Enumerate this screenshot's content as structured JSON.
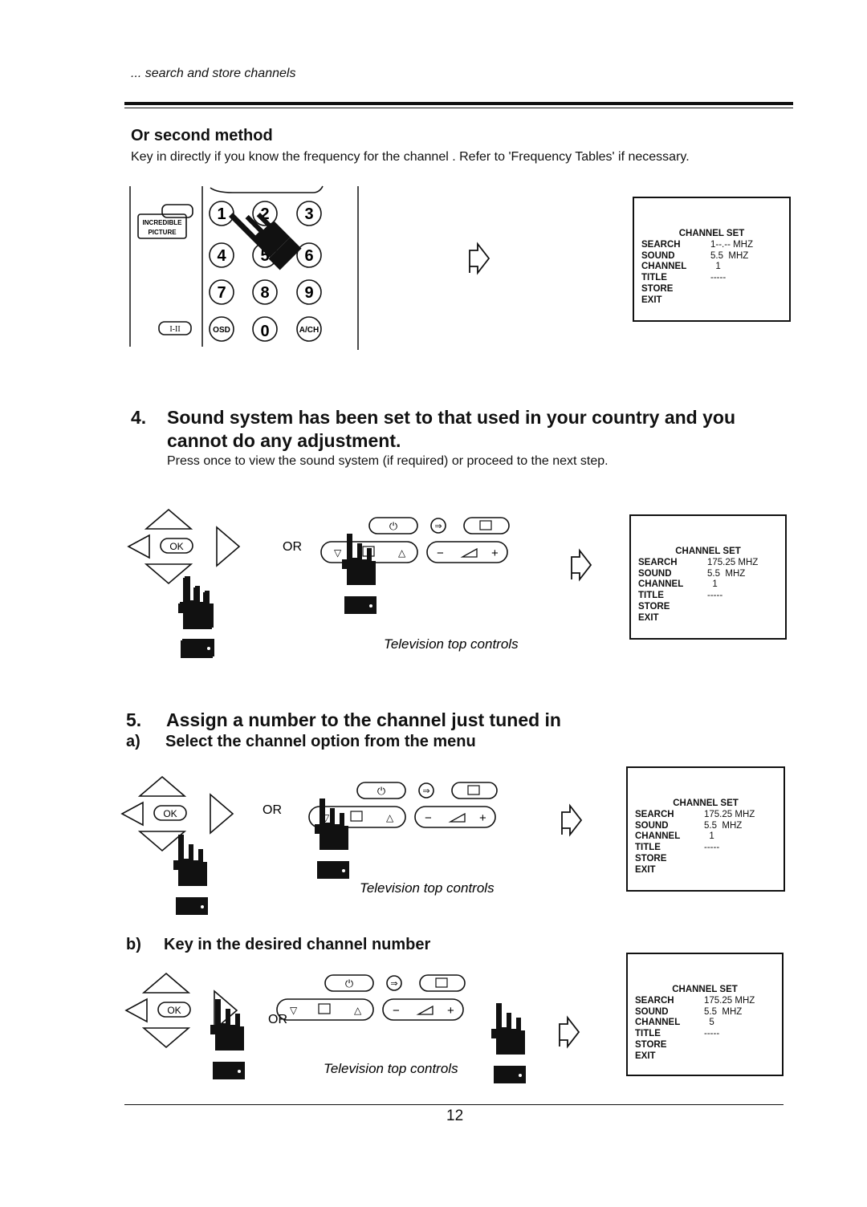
{
  "header": {
    "running_title": "... search and store channels"
  },
  "second_method": {
    "heading": "Or second method",
    "text": "Key in directly if you know the frequency for the channel . Refer to 'Frequency Tables' if necessary."
  },
  "remote": {
    "incredible_picture": [
      "INCREDIBLE",
      "PICTURE"
    ],
    "sound_key": "I-II",
    "digits": [
      "1",
      "2",
      "3",
      "4",
      "5",
      "6",
      "7",
      "8",
      "9"
    ],
    "osd": "OSD",
    "zero": "0",
    "ach": "A/CH"
  },
  "step4": {
    "number": "4.",
    "heading_line1": "Sound system has been set to that used in your country and you",
    "heading_line2": "cannot do any adjustment.",
    "text": "Press once to view the sound system (if required) or proceed to the next step."
  },
  "step5": {
    "number": "5.",
    "heading": "Assign a number to the channel just tuned in",
    "a_label": "a)",
    "a_text": "Select the channel option from the menu",
    "b_label": "b)",
    "b_text": "Key in the desired channel number"
  },
  "diagram": {
    "ok": "OK",
    "or": "OR",
    "tv_caption": "Television top controls"
  },
  "menus": [
    {
      "title": "CHANNEL SET",
      "rows": [
        [
          "SEARCH",
          "1--.-- MHZ"
        ],
        [
          "SOUND",
          "5.5  MHZ"
        ],
        [
          "CHANNEL",
          "  1"
        ],
        [
          "TITLE",
          "-----"
        ],
        [
          "STORE",
          ""
        ],
        [
          "EXIT",
          ""
        ]
      ]
    },
    {
      "title": "CHANNEL SET",
      "rows": [
        [
          "SEARCH",
          "175.25 MHZ"
        ],
        [
          "SOUND",
          "5.5  MHZ"
        ],
        [
          "CHANNEL",
          "  1"
        ],
        [
          "TITLE",
          "-----"
        ],
        [
          "STORE",
          ""
        ],
        [
          "EXIT",
          ""
        ]
      ]
    },
    {
      "title": "CHANNEL SET",
      "rows": [
        [
          "SEARCH",
          "175.25 MHZ"
        ],
        [
          "SOUND",
          "5.5  MHZ"
        ],
        [
          "CHANNEL",
          "  1"
        ],
        [
          "TITLE",
          "-----"
        ],
        [
          "STORE",
          ""
        ],
        [
          "EXIT",
          ""
        ]
      ]
    },
    {
      "title": "CHANNEL SET",
      "rows": [
        [
          "SEARCH",
          "175.25 MHZ"
        ],
        [
          "SOUND",
          "5.5  MHZ"
        ],
        [
          "CHANNEL",
          "  5"
        ],
        [
          "TITLE",
          "-----"
        ],
        [
          "STORE",
          ""
        ],
        [
          "EXIT",
          ""
        ]
      ]
    }
  ],
  "footer": {
    "page_number": "12"
  }
}
